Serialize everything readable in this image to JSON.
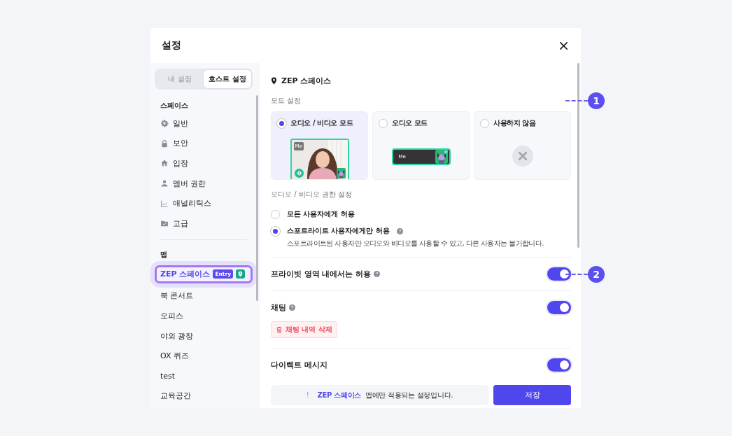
{
  "window": {
    "title": "설정"
  },
  "tabs": [
    {
      "label": "내 설정",
      "selected": false
    },
    {
      "label": "호스트 설정",
      "selected": true
    }
  ],
  "sidebar": {
    "sections": [
      {
        "heading": "스페이스",
        "items": [
          {
            "label": "일반",
            "selected": false
          },
          {
            "label": "보안",
            "selected": false
          },
          {
            "label": "입장",
            "selected": false
          },
          {
            "label": "멤버 권한",
            "selected": false
          },
          {
            "label": "애널리틱스",
            "selected": false
          },
          {
            "label": "고급",
            "selected": false
          }
        ]
      },
      {
        "heading": "맵",
        "items": [
          {
            "label": "ZEP 스페이스",
            "selected": true,
            "badge": "Entry",
            "pin": true
          },
          {
            "label": "북 콘서트",
            "selected": false
          },
          {
            "label": "오피스",
            "selected": false
          },
          {
            "label": "야외 광장",
            "selected": false
          },
          {
            "label": "OX 퀴즈",
            "selected": false
          },
          {
            "label": "test",
            "selected": false
          },
          {
            "label": "교육공간",
            "selected": false
          }
        ]
      }
    ]
  },
  "content": {
    "title": "ZEP 스페이스",
    "mode_setting": {
      "label": "모드 설정",
      "options": [
        {
          "label": "오디오 / 비디오 모드",
          "selected": true,
          "kind": "video",
          "tag": "Me"
        },
        {
          "label": "오디오 모드",
          "selected": false,
          "kind": "audio",
          "tag": "Me"
        },
        {
          "label": "사용하지 않음",
          "selected": false,
          "kind": "none"
        }
      ]
    },
    "permission": {
      "label": "오디오 / 비디오 권한 설정",
      "options": [
        {
          "label": "모든 사용자에게 허용",
          "selected": false,
          "help": false
        },
        {
          "label": "스포트라이트 사용자에게만 허용",
          "selected": true,
          "help": true,
          "description": "스포트라이트된 사용자만 오디오와 비디오를 사용할 수 있고, 다른 사용자는 불가합니다."
        }
      ]
    },
    "toggles": [
      {
        "label": "프라이빗 영역 내에서는 허용",
        "help": true,
        "on": true
      },
      {
        "label": "채팅",
        "help": true,
        "on": true,
        "action": "채팅 내역 삭제"
      },
      {
        "label": "다이렉트 메시지",
        "help": false,
        "on": true
      }
    ]
  },
  "footer": {
    "notice_icon": "!",
    "notice_map": "ZEP 스페이스",
    "notice_text": "맵에만 적용되는 설정입니다.",
    "save": "저장"
  },
  "annotations": [
    {
      "number": "1"
    },
    {
      "number": "2"
    }
  ]
}
